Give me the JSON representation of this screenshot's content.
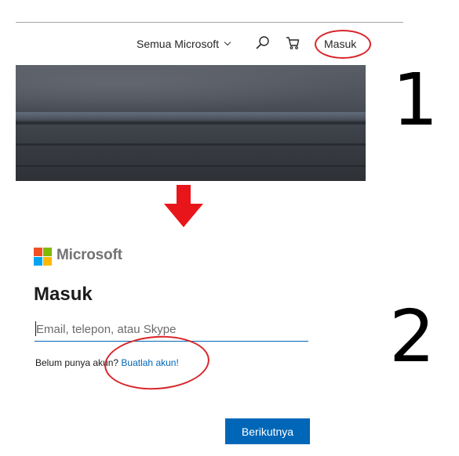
{
  "step1": {
    "number": "1",
    "nav": {
      "all_microsoft_label": "Semua Microsoft",
      "signin_label": "Masuk"
    },
    "icons": [
      "search-icon",
      "cart-icon",
      "chevron-down-icon"
    ]
  },
  "step2": {
    "number": "2",
    "brand": "Microsoft",
    "title": "Masuk",
    "email_placeholder": "Email, telepon, atau Skype",
    "email_value": "",
    "no_account_text": "Belum punya akun? ",
    "create_account_link": "Buatlah akun!",
    "next_button": "Berikutnya"
  },
  "colors": {
    "annotation_red": "#d9252b",
    "ms_blue": "#0067b8",
    "logo_red": "#f25022",
    "logo_green": "#7fba00",
    "logo_blue": "#00a4ef",
    "logo_yellow": "#ffb900"
  }
}
